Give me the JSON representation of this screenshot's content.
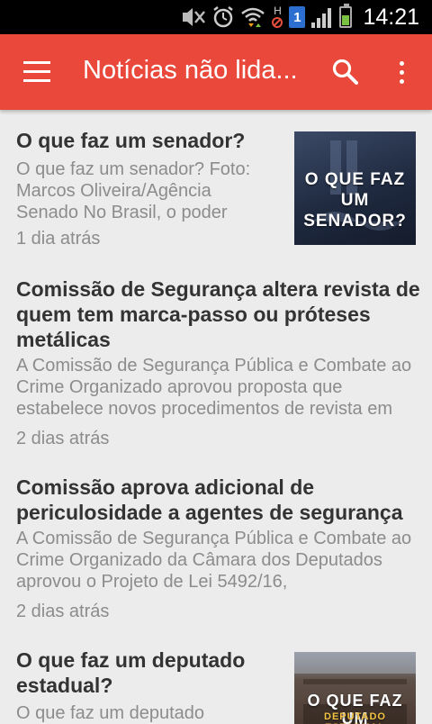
{
  "status_bar": {
    "time": "14:21",
    "icons": [
      "mute-icon",
      "alarm-icon",
      "wifi-icon",
      "h-signal-icon",
      "notification-1-icon",
      "cell-signal-icon",
      "battery-icon"
    ],
    "notification_badge": "1",
    "network_label": "H"
  },
  "app_bar": {
    "title": "Notícias não lida...",
    "background": "#e9483b"
  },
  "articles": [
    {
      "title": "O que faz um senador?",
      "snippet": "O que faz um senador? Foto: Marcos Oliveira/Agência Senado No Brasil, o poder",
      "date": "1 dia atrás",
      "thumbnail_text": "O QUE FAZ UM SENADOR?"
    },
    {
      "title": "Comissão de Segurança altera revista de quem tem marca-passo ou próteses metálicas",
      "snippet": "A Comissão de Segurança Pública e Combate ao Crime Organizado aprovou proposta que estabelece novos procedimentos de revista em",
      "date": "2 dias atrás"
    },
    {
      "title": "Comissão aprova adicional de periculosidade a agentes de segurança",
      "snippet": "A Comissão de Segurança Pública e Combate ao Crime Organizado da Câmara dos Deputados aprovou o Projeto de Lei 5492/16,",
      "date": "2 dias atrás"
    },
    {
      "title": "O que faz um deputado estadual?",
      "snippet": "O que faz um deputado",
      "thumbnail_text": "O QUE FAZ UM",
      "thumbnail_subtext": "DEPUTADO ESTADUAL"
    }
  ]
}
